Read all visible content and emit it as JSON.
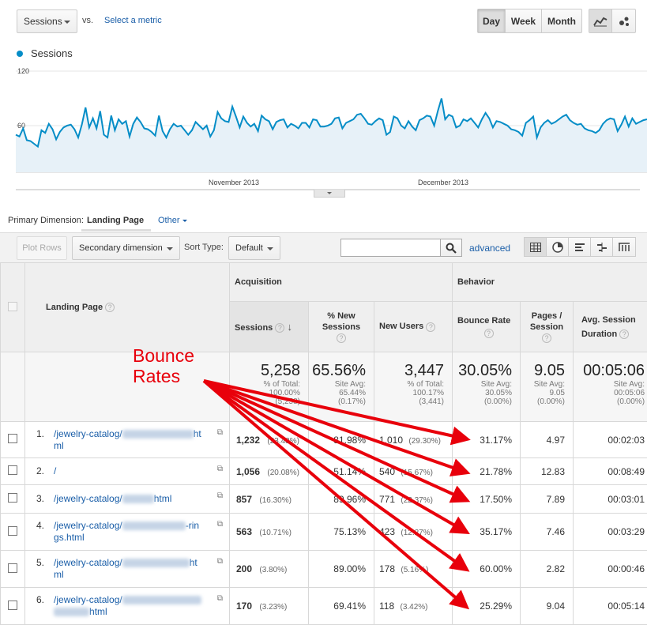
{
  "controls": {
    "metric": "Sessions",
    "vs": "vs.",
    "select_metric": "Select a metric",
    "period": {
      "day": "Day",
      "week": "Week",
      "month": "Month"
    },
    "view_icons": [
      "line-chart-icon",
      "motion-chart-icon"
    ]
  },
  "chart_data": {
    "type": "area",
    "series": [
      {
        "name": "Sessions",
        "color": "#058dc7",
        "values": [
          50,
          48,
          57,
          44,
          43,
          40,
          37,
          55,
          52,
          62,
          56,
          45,
          53,
          58,
          60,
          61,
          56,
          47,
          61,
          80,
          58,
          68,
          57,
          76,
          50,
          47,
          71,
          55,
          67,
          62,
          65,
          48,
          62,
          69,
          64,
          57,
          56,
          53,
          49,
          71,
          54,
          47,
          56,
          62,
          59,
          60,
          55,
          50,
          55,
          64,
          60,
          56,
          60,
          48,
          55,
          75,
          68,
          65,
          64,
          81,
          70,
          58,
          70,
          63,
          59,
          62,
          54,
          71,
          67,
          65,
          56,
          64,
          66,
          67,
          58,
          62,
          60,
          57,
          63,
          63,
          58,
          67,
          66,
          59,
          59,
          60,
          62,
          68,
          69,
          57,
          63,
          65,
          67,
          72,
          73,
          68,
          62,
          61,
          65,
          68,
          66,
          50,
          53,
          70,
          68,
          60,
          57,
          65,
          59,
          55,
          66,
          68,
          71,
          70,
          60,
          76,
          90,
          67,
          72,
          70,
          58,
          60,
          67,
          65,
          68,
          63,
          58,
          67,
          74,
          68,
          58,
          65,
          64,
          62,
          60,
          56,
          55,
          53,
          49,
          63,
          66,
          70,
          47,
          58,
          63,
          66,
          62,
          64,
          67,
          70,
          72,
          66,
          63,
          61,
          62,
          57,
          55,
          54,
          52,
          55,
          62,
          66,
          68,
          67,
          54,
          61,
          70,
          59,
          68,
          62,
          64,
          66,
          67
        ]
      }
    ],
    "y_ticks": [
      60,
      120
    ],
    "ylim": [
      0,
      140
    ],
    "x_labels": [
      "November 2013",
      "December 2013"
    ],
    "grid": true
  },
  "primary_dimension": {
    "label": "Primary Dimension:",
    "active": "Landing Page",
    "other": "Other"
  },
  "toolbar": {
    "plot_rows": "Plot Rows",
    "secondary_dimension": "Secondary dimension",
    "sort_type_label": "Sort Type:",
    "sort_type_value": "Default",
    "advanced": "advanced",
    "view_icons": [
      "data-table-icon",
      "pie-chart-icon",
      "performance-icon",
      "comparison-icon",
      "pivot-icon"
    ]
  },
  "table": {
    "groups": {
      "acquisition": "Acquisition",
      "behavior": "Behavior"
    },
    "columns": {
      "landing_page": "Landing Page",
      "sessions": "Sessions",
      "new_sessions": "% New Sessions",
      "new_users": "New Users",
      "bounce_rate": "Bounce Rate",
      "pages_session": "Pages / Session",
      "avg_duration": "Avg. Session Duration"
    },
    "totals": {
      "sessions": "5,258",
      "sessions_sub1": "% of Total:",
      "sessions_sub2": "100.00%",
      "sessions_sub3": "(5,258)",
      "new_sessions": "65.56%",
      "new_sessions_sub1": "Site Avg:",
      "new_sessions_sub2": "65.44%",
      "new_sessions_sub3": "(0.17%)",
      "new_users": "3,447",
      "new_users_sub1": "% of Total:",
      "new_users_sub2": "100.17%",
      "new_users_sub3": "(3,441)",
      "bounce_rate": "30.05%",
      "bounce_rate_sub1": "Site Avg:",
      "bounce_rate_sub2": "30.05%",
      "bounce_rate_sub3": "(0.00%)",
      "pages_session": "9.05",
      "pages_session_sub1": "Site Avg:",
      "pages_session_sub2": "9.05",
      "pages_session_sub3": "(0.00%)",
      "avg_duration": "00:05:06",
      "avg_duration_sub1": "Site Avg:",
      "avg_duration_sub2": "00:05:06",
      "avg_duration_sub3": "(0.00%)"
    },
    "rows": [
      {
        "idx": "1.",
        "page_a": "/jewelry-catalog/",
        "page_b": "ht",
        "page_c": "ml",
        "sessions": "1,232",
        "sessions_pct": "(23.43%)",
        "new_sessions": "81.98%",
        "new_users": "1,010",
        "new_users_pct": "(29.30%)",
        "bounce_rate": "31.17%",
        "pages_session": "4.97",
        "avg_duration": "00:02:03"
      },
      {
        "idx": "2.",
        "page_a": "/",
        "page_b": "",
        "page_c": "",
        "sessions": "1,056",
        "sessions_pct": "(20.08%)",
        "new_sessions": "51.14%",
        "new_users": "540",
        "new_users_pct": "(15.67%)",
        "bounce_rate": "21.78%",
        "pages_session": "12.83",
        "avg_duration": "00:08:49"
      },
      {
        "idx": "3.",
        "page_a": "/jewelry-catalog/",
        "page_b": "html",
        "page_c": "",
        "sessions": "857",
        "sessions_pct": "(16.30%)",
        "new_sessions": "89.96%",
        "new_users": "771",
        "new_users_pct": "(22.37%)",
        "bounce_rate": "17.50%",
        "pages_session": "7.89",
        "avg_duration": "00:03:01"
      },
      {
        "idx": "4.",
        "page_a": "/jewelry-catalog/",
        "page_b": "-rin",
        "page_c": "gs.html",
        "sessions": "563",
        "sessions_pct": "(10.71%)",
        "new_sessions": "75.13%",
        "new_users": "423",
        "new_users_pct": "(12.27%)",
        "bounce_rate": "35.17%",
        "pages_session": "7.46",
        "avg_duration": "00:03:29"
      },
      {
        "idx": "5.",
        "page_a": "/jewelry-catalog/",
        "page_b": "ht",
        "page_c": "ml",
        "sessions": "200",
        "sessions_pct": "(3.80%)",
        "new_sessions": "89.00%",
        "new_users": "178",
        "new_users_pct": "(5.16%)",
        "bounce_rate": "60.00%",
        "pages_session": "2.82",
        "avg_duration": "00:00:46"
      },
      {
        "idx": "6.",
        "page_a": "/jewelry-catalog/",
        "page_b": "",
        "page_c": "html",
        "sessions": "170",
        "sessions_pct": "(3.23%)",
        "new_sessions": "69.41%",
        "new_users": "118",
        "new_users_pct": "(3.42%)",
        "bounce_rate": "25.29%",
        "pages_session": "9.04",
        "avg_duration": "00:05:14"
      }
    ]
  },
  "annotation": {
    "line1": "Bounce",
    "line2": "Rates",
    "color": "#e8000b"
  }
}
